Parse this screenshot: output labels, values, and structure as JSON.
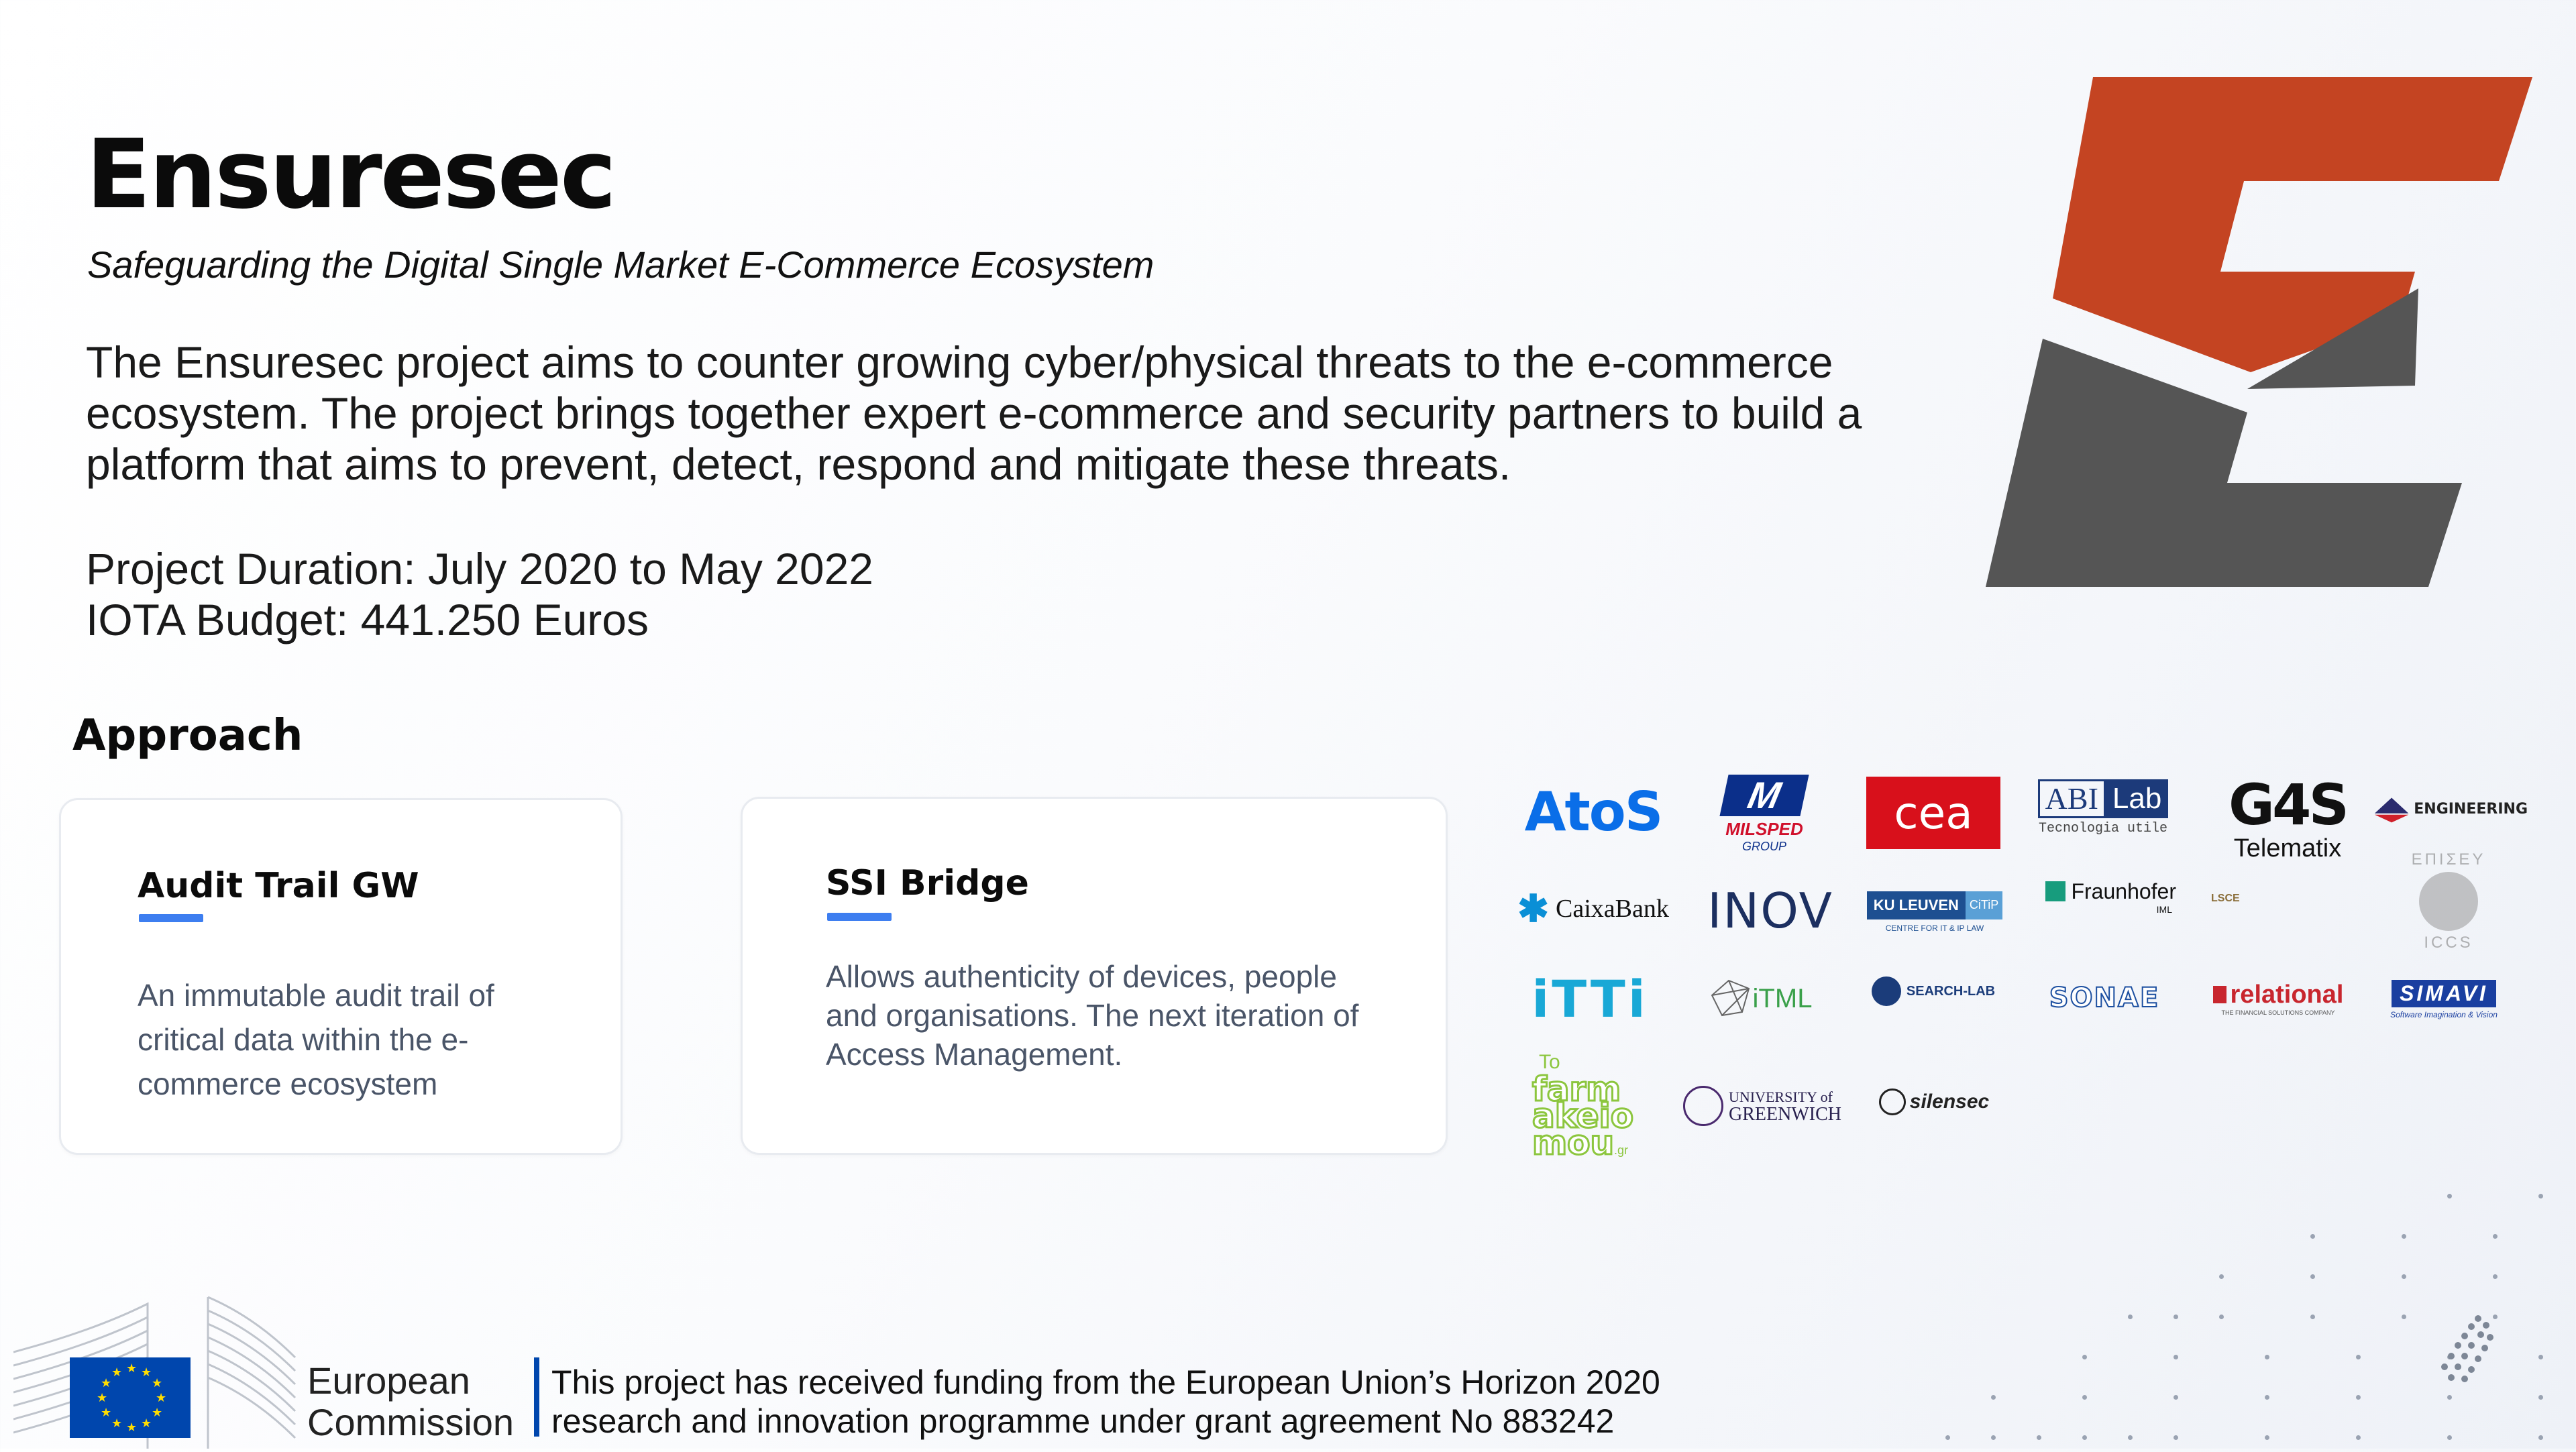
{
  "header": {
    "title": "Ensuresec",
    "subtitle": "Safeguarding the Digital Single Market E-Commerce Ecosystem"
  },
  "description": {
    "line1": "The Ensuresec project aims to counter growing cyber/physical threats to the e-commerce",
    "line2": "ecosystem. The project brings together expert e-commerce and security partners to build a",
    "line3": "platform that aims to prevent, detect, respond and mitigate these threats."
  },
  "project": {
    "duration": "Project Duration: July 2020 to May 2022",
    "budget": "IOTA Budget: 441.250 Euros"
  },
  "approach": {
    "heading": "Approach",
    "cards": [
      {
        "title": "Audit Trail GW",
        "lines": [
          "An immutable audit trail of",
          "critical data within the e-",
          "commerce ecosystem"
        ]
      },
      {
        "title": "SSI Bridge",
        "lines": [
          "Allows authenticity of devices, people",
          "and organisations. The next iteration of",
          "Access Management."
        ]
      }
    ]
  },
  "partners": {
    "atos": "AtoS",
    "milsped_m": "M",
    "milsped": "MILSPED",
    "milsped_group": "GROUP",
    "cea": "cea",
    "abilab_abi": "ABI",
    "abilab_lab": "Lab",
    "abilab_tag": "Tecnologia utile",
    "g4s": "G4S",
    "g4s_sub": "Telematix",
    "engineering": "ENGINEERING",
    "caixabank": "CaixaBank",
    "inov": "INOV",
    "kuleuven": "KU LEUVEN",
    "kuleuven_citip": "CiTiP",
    "kuleuven_sub": "CENTRE FOR IT & IP LAW",
    "fraunhofer": "Fraunhofer",
    "fraunhofer_sub": "IML",
    "lsce": "LSCE",
    "iccs": "ICCS",
    "iccs_top": "ΕΠΙΣΕΥ",
    "itti": "iTTi",
    "itml": "iTML",
    "searchlab": "SEARCH-LAB",
    "sonae": "SONAE",
    "relational": "relational",
    "relational_sub": "THE FINANCIAL SOLUTIONS COMPANY",
    "simavi": "SIMAVI",
    "simavi_sub": "Software Imagination & Vision",
    "tofarm_to": "To",
    "tofarm_1": "farm",
    "tofarm_2": "akeio",
    "tofarm_3": "mou",
    "tofarm_gr": ".gr",
    "greenwich_1": "UNIVERSITY of",
    "greenwich_2": "GREENWICH",
    "silensec": "silensec"
  },
  "footer": {
    "eu_name_1": "European",
    "eu_name_2": "Commission",
    "funding_1": "This project has received funding from the European Union’s Horizon 2020",
    "funding_2": "research and innovation programme under grant agreement No 883242"
  },
  "colors": {
    "logo_orange": "#c44422",
    "logo_gray": "#555555",
    "accent_blue": "#3d7ef0",
    "eu_blue": "#0046ad",
    "eu_star": "#ffdd00"
  }
}
